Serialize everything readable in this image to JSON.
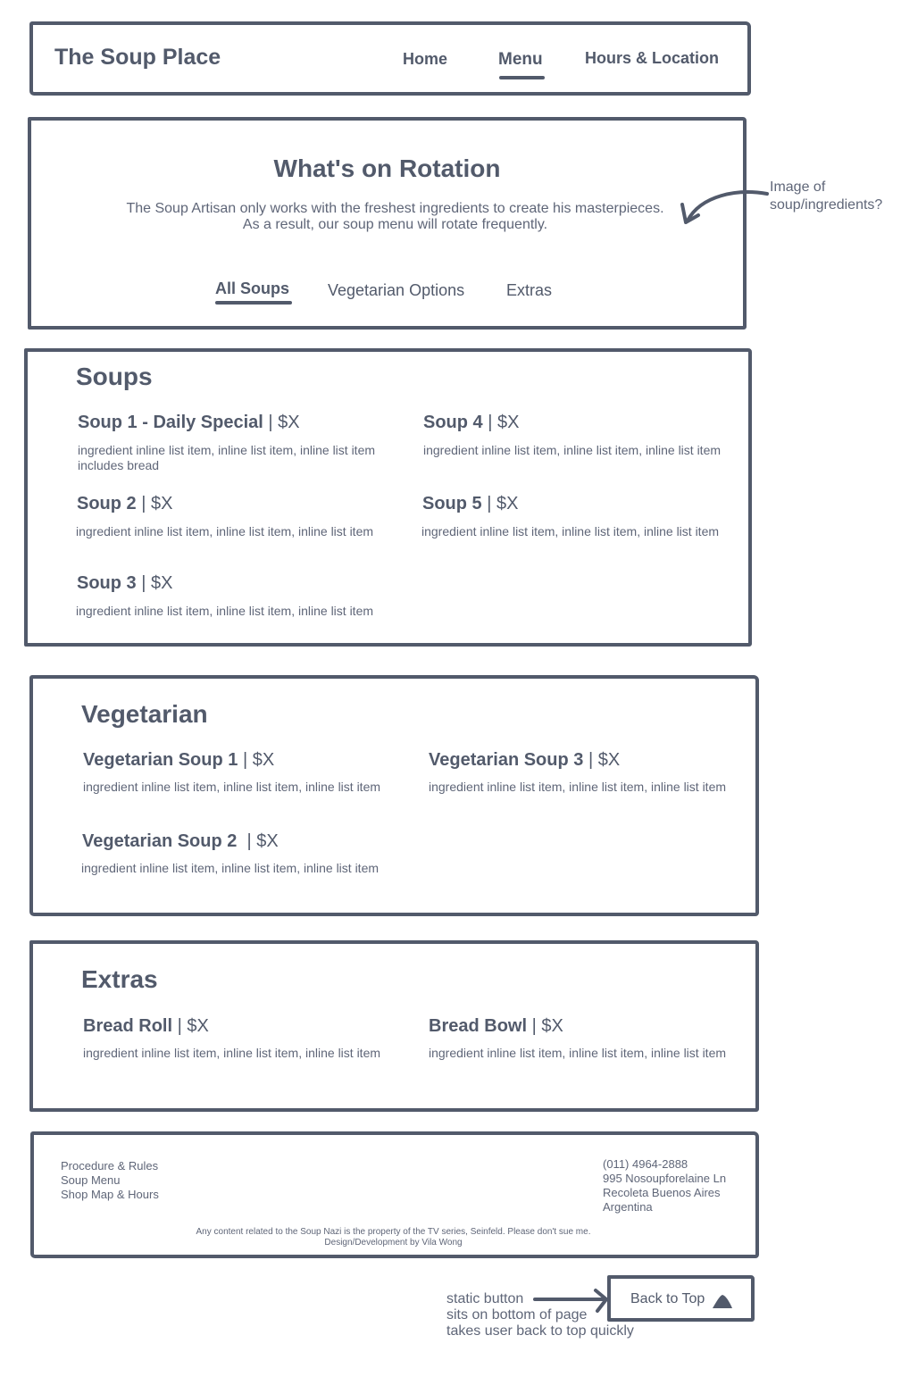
{
  "header": {
    "brand": "The Soup Place",
    "nav": [
      "Home",
      "Menu",
      "Hours & Location"
    ]
  },
  "hero": {
    "title": "What's on Rotation",
    "desc_line1": "The Soup Artisan only works with the freshest ingredients to create his masterpieces.",
    "desc_line2": "As a result, our soup menu will rotate frequently.",
    "tabs": [
      "All Soups",
      "Vegetarian Options",
      "Extras"
    ]
  },
  "annotations": {
    "image_line1": "Image of",
    "image_line2": "soup/ingredients?",
    "static_line1": "static button",
    "static_line2": "sits on bottom of page",
    "static_line3": "takes user back to top quickly"
  },
  "sections": {
    "soups": {
      "title": "Soups",
      "items": [
        {
          "name": "Soup 1 - Daily Special",
          "price": " | $X",
          "desc": "ingredient inline list item, inline list item, inline list item",
          "extra": "includes bread"
        },
        {
          "name": "Soup 4",
          "price": " | $X",
          "desc": "ingredient inline list item, inline list item, inline list item"
        },
        {
          "name": "Soup 2",
          "price": " | $X",
          "desc": "ingredient inline list item, inline list item, inline list item"
        },
        {
          "name": "Soup 5",
          "price": " | $X",
          "desc": "ingredient inline list item, inline list item, inline list item"
        },
        {
          "name": "Soup 3",
          "price": " | $X",
          "desc": "ingredient inline list item, inline list item, inline list item"
        }
      ]
    },
    "vegetarian": {
      "title": "Vegetarian",
      "items": [
        {
          "name": "Vegetarian Soup 1",
          "price": " | $X",
          "desc": "ingredient inline list item, inline list item, inline list item"
        },
        {
          "name": "Vegetarian Soup 3",
          "price": " | $X",
          "desc": "ingredient inline list item, inline list item, inline list item"
        },
        {
          "name": "Vegetarian Soup 2",
          "price": "  | $X",
          "desc": "ingredient inline list item, inline list item, inline list item"
        }
      ]
    },
    "extras": {
      "title": "Extras",
      "items": [
        {
          "name": "Bread Roll",
          "price": " | $X",
          "desc": "ingredient inline list item, inline list item, inline list item"
        },
        {
          "name": "Bread Bowl",
          "price": " | $X",
          "desc": "ingredient inline list item, inline list item, inline list item"
        }
      ]
    }
  },
  "footer": {
    "links": [
      "Procedure & Rules",
      "Soup Menu",
      "Shop Map & Hours"
    ],
    "address": [
      "(011) 4964-2888",
      "995 Nosoupforelaine Ln",
      "Recoleta Buenos Aires",
      "Argentina"
    ],
    "note_line1": "Any content related to the Soup Nazi is the property of the TV series, Seinfeld. Please don't sue me.",
    "note_line2": "Design/Development by Vila Wong"
  },
  "back_to_top": {
    "label": "Back to Top",
    "icon": "up-arrow-icon"
  }
}
